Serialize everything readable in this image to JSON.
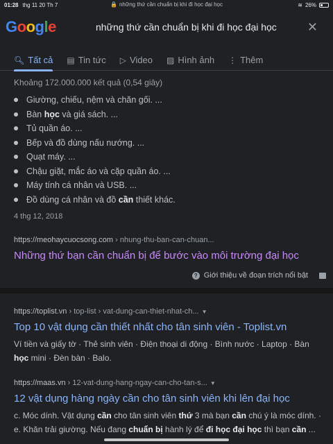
{
  "status": {
    "time": "01:28",
    "date": "thg 11 20 Th 7",
    "url": "những thứ cần chuẩn bị khi đi học đại học",
    "battery": "26%"
  },
  "logo_text": "Google",
  "search": {
    "query": "những thứ cần chuẩn bị khi đi học đại học"
  },
  "tabs": [
    {
      "label": "Tất cả",
      "icon": "search-icon",
      "active": true
    },
    {
      "label": "Tin tức",
      "icon": "news-icon",
      "active": false
    },
    {
      "label": "Video",
      "icon": "video-icon",
      "active": false
    },
    {
      "label": "Hình ảnh",
      "icon": "image-icon",
      "active": false
    },
    {
      "label": "Thêm",
      "icon": "more-icon",
      "active": false
    }
  ],
  "stats": "Khoảng 172.000.000 kết quả (0,54 giây)",
  "snippet": {
    "items": [
      [
        "Giường, chiếu, nệm và chăn gối. ...",
        ""
      ],
      [
        "Bàn ",
        "học",
        " và giá sách. ..."
      ],
      [
        "Tủ quần áo. ...",
        ""
      ],
      [
        "Bếp và đồ dùng nấu nướng. ...",
        ""
      ],
      [
        "Quạt máy. ...",
        ""
      ],
      [
        "Chậu giặt, mắc áo và cặp quần áo. ...",
        ""
      ],
      [
        "Máy tính cá nhân và USB. ...",
        ""
      ],
      [
        "Đồ dùng cá nhân và đồ ",
        "cần",
        " thiết khác."
      ]
    ],
    "date": "4 thg 12, 2018",
    "cite_domain": "https://meohaycuocsong.com",
    "cite_path": " › nhung-thu-ban-can-chuan...",
    "title": "Những thứ bạn cần chuẩn bị để bước vào môi trường đại học",
    "about": "Giới thiệu về đoạn trích nổi bật"
  },
  "results": [
    {
      "cite_domain": "https://toplist.vn",
      "cite_path": " › top-list › vat-dung-can-thiet-nhat-ch...",
      "title": "Top 10 vật dụng cần thiết nhất cho tân sinh viên - Toplist.vn",
      "desc_html": "Ví tiền và giấy tờ · Thẻ sinh viên · Điện thoại di động · Bình nước · Laptop · Bàn <b>học</b> mini · Đèn bàn · Balo."
    },
    {
      "cite_domain": "https://maas.vn",
      "cite_path": " › 12-vat-dung-hang-ngay-can-cho-tan-s...",
      "title": "12 vật dụng hàng ngày cần cho tân sinh viên khi lên đại học",
      "desc_html": "c. Móc dính. Vật dụng <b>cần</b> cho tân sinh viên <b>thứ</b> 3 mà bạn <b>cần</b> chú ý là móc dính. ·<br>e. Khăn trải giường. Nếu đang <b>chuẩn bị</b> hành lý để <b>đi học đại học</b> thì bạn <b>cần</b> ..."
    }
  ]
}
